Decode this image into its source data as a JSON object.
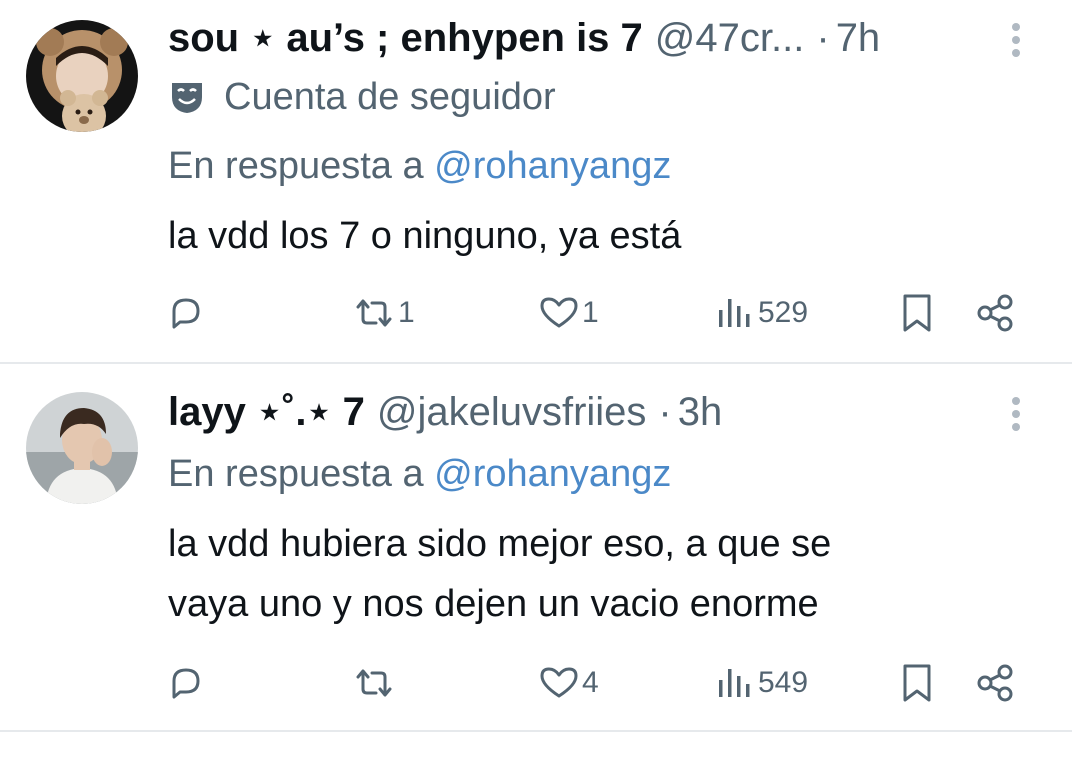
{
  "tweets": [
    {
      "display_name": "sou ⋆ au’s ; enhypen is 7",
      "handle": "@47cr...",
      "separator": "·",
      "time": "7h",
      "account_label": "Cuenta de seguidor",
      "reply_prefix": "En respuesta a",
      "reply_mention": "@rohanyangz",
      "text": "la vdd los 7 o ninguno, ya está",
      "stats": {
        "replies": "",
        "reposts": "1",
        "likes": "1",
        "views": "529"
      },
      "icons": {
        "account_label": "masks-icon",
        "reply": "reply-icon",
        "repost": "repost-icon",
        "like": "heart-icon",
        "views": "views-icon",
        "bookmark": "bookmark-icon",
        "share": "share-icon",
        "more": "more-vertical-icon"
      }
    },
    {
      "display_name": "layy ⋆˚.⋆ 7",
      "handle": "@jakeluvsfriies",
      "separator": "·",
      "time": "3h",
      "reply_prefix": "En respuesta a",
      "reply_mention": "@rohanyangz",
      "text_lines": [
        "la vdd hubiera sido mejor eso, a que se",
        "vaya uno y nos dejen un vacio enorme"
      ],
      "stats": {
        "replies": "",
        "reposts": "",
        "likes": "4",
        "views": "549"
      },
      "icons": {
        "reply": "reply-icon",
        "repost": "repost-icon",
        "like": "heart-icon",
        "views": "views-icon",
        "bookmark": "bookmark-icon",
        "share": "share-icon",
        "more": "more-vertical-icon"
      }
    }
  ],
  "colors": {
    "primary_text": "#0f1419",
    "secondary_text": "#536471",
    "mention": "#4b89c8",
    "divider": "#e6e9ec",
    "icon": "#536471"
  }
}
